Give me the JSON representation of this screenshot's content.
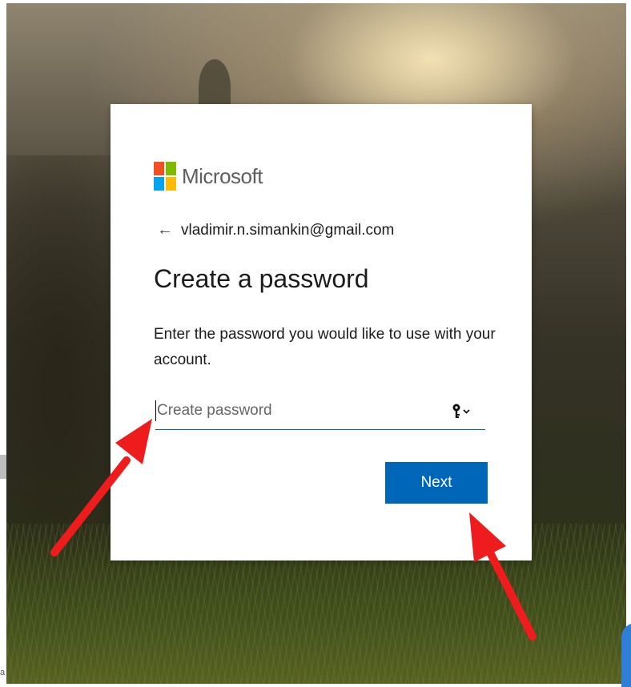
{
  "brand": {
    "name": "Microsoft",
    "logo_colors": [
      "#f25022",
      "#7fba00",
      "#00a4ef",
      "#ffb900"
    ]
  },
  "identity": {
    "back_icon": "back-arrow-icon",
    "email": "vladimir.n.simankin@gmail.com"
  },
  "page": {
    "title": "Create a password",
    "description": "Enter the password you would like to use with your account."
  },
  "password_field": {
    "placeholder": "Create password",
    "value": "",
    "toggle_icon": "key-dropdown-icon"
  },
  "actions": {
    "next_label": "Next"
  },
  "annotations": {
    "arrow_color": "#ee1c1c",
    "edge_text": "a"
  },
  "colors": {
    "accent": "#0067b8"
  }
}
